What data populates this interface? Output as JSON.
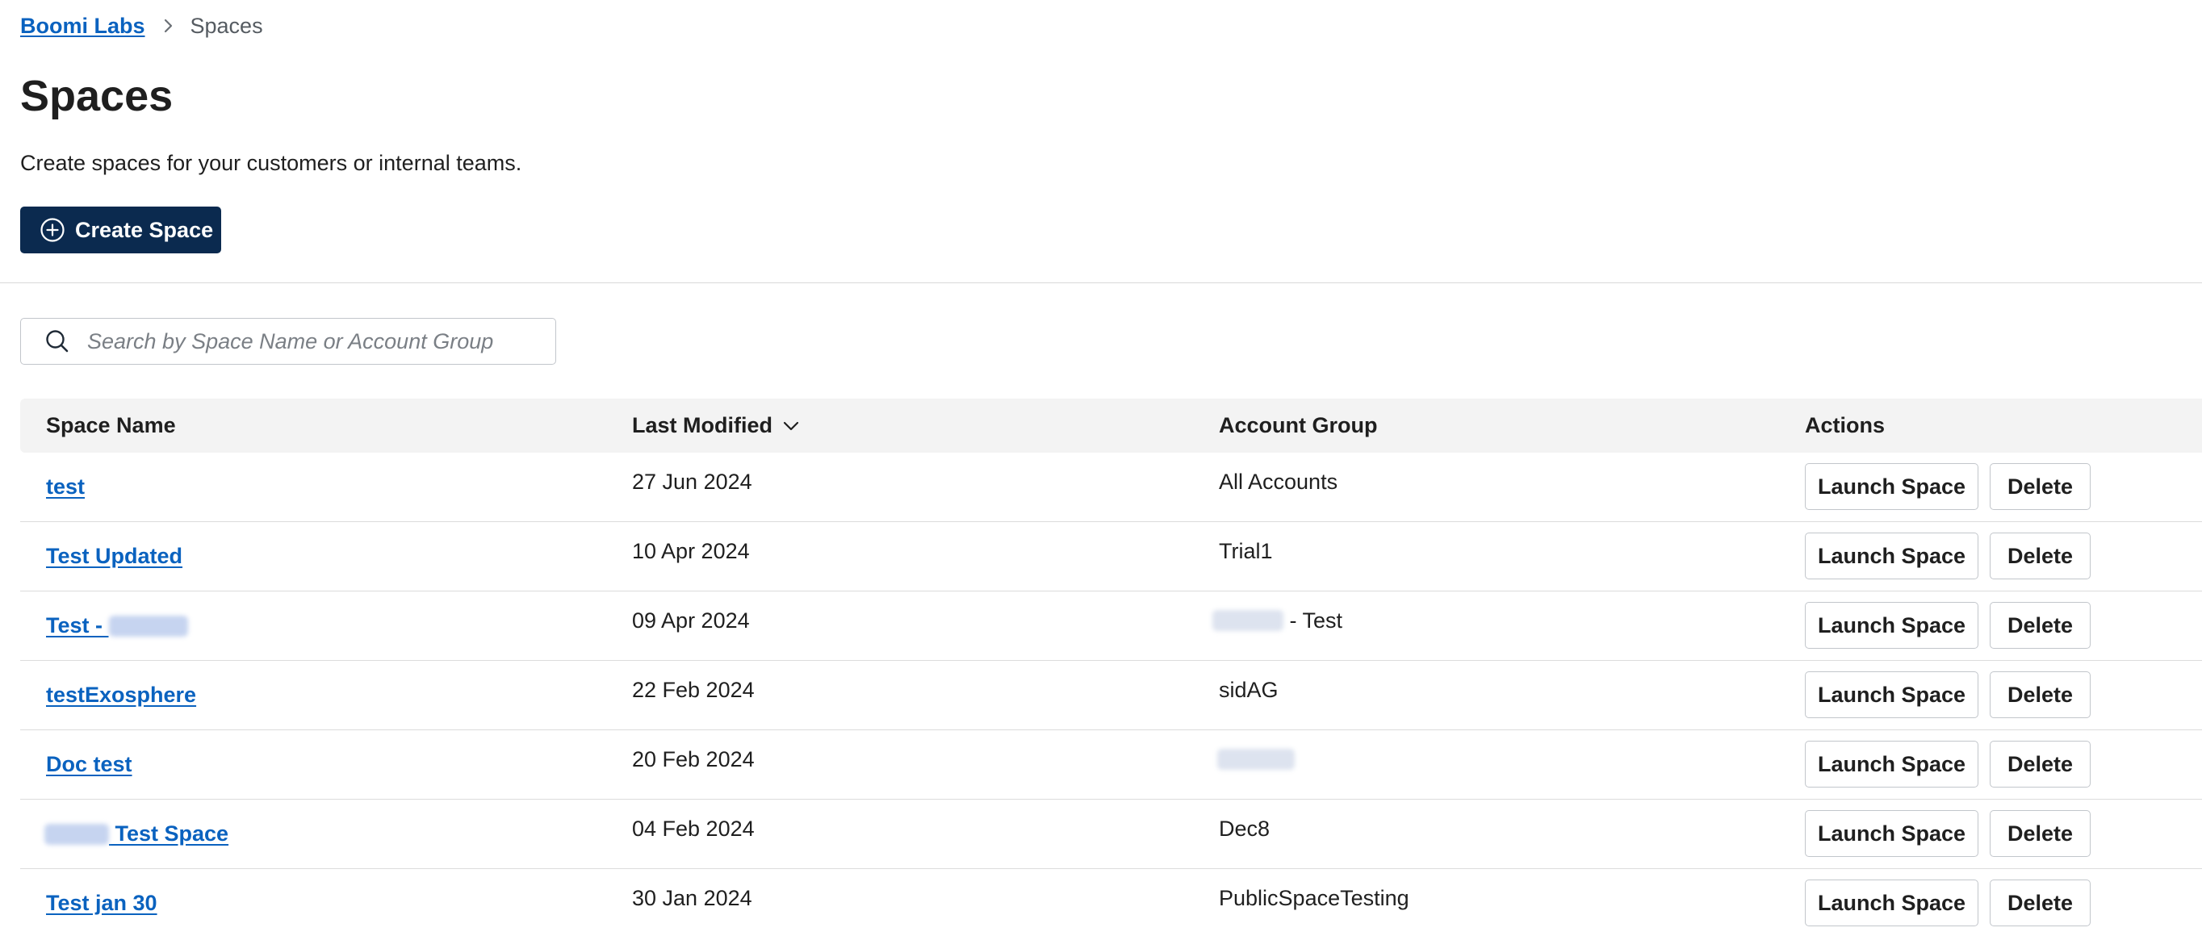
{
  "breadcrumb": {
    "root": "Boomi Labs",
    "current": "Spaces"
  },
  "page": {
    "title": "Spaces",
    "subtitle": "Create spaces for your customers or internal teams."
  },
  "toolbar": {
    "create_label": "Create Space"
  },
  "search": {
    "placeholder": "Search by Space Name or Account Group"
  },
  "table": {
    "headers": {
      "name": "Space Name",
      "modified": "Last Modified",
      "group": "Account Group",
      "actions": "Actions"
    },
    "sort": {
      "column": "Last Modified",
      "direction": "descending"
    },
    "rows": [
      {
        "name": "test",
        "modified": "27 Jun 2024",
        "group": "All Accounts"
      },
      {
        "name": "Test Updated",
        "modified": "10 Apr 2024",
        "group": "Trial1"
      },
      {
        "name": "Test - ",
        "modified": "09 Apr 2024",
        "group": " - Test"
      },
      {
        "name": "testExosphere",
        "modified": "22 Feb 2024",
        "group": "sidAG"
      },
      {
        "name": "Doc test",
        "modified": "20 Feb 2024",
        "group": ""
      },
      {
        "name": " Test Space",
        "modified": "04 Feb 2024",
        "group": "Dec8"
      },
      {
        "name": "Test jan 30",
        "modified": "30 Jan 2024",
        "group": "PublicSpaceTesting"
      }
    ],
    "launch_label": "Launch Space",
    "delete_label": "Delete"
  },
  "colors": {
    "primary": "#0b2a4f",
    "link": "#0a62bf",
    "header_bg": "#f3f3f3",
    "border": "#c2c6cb"
  },
  "icons": {
    "create": "plus-circle-icon",
    "search": "search-icon",
    "sort": "chevron-down-icon",
    "breadcrumb_separator": "chevron-right-icon"
  }
}
